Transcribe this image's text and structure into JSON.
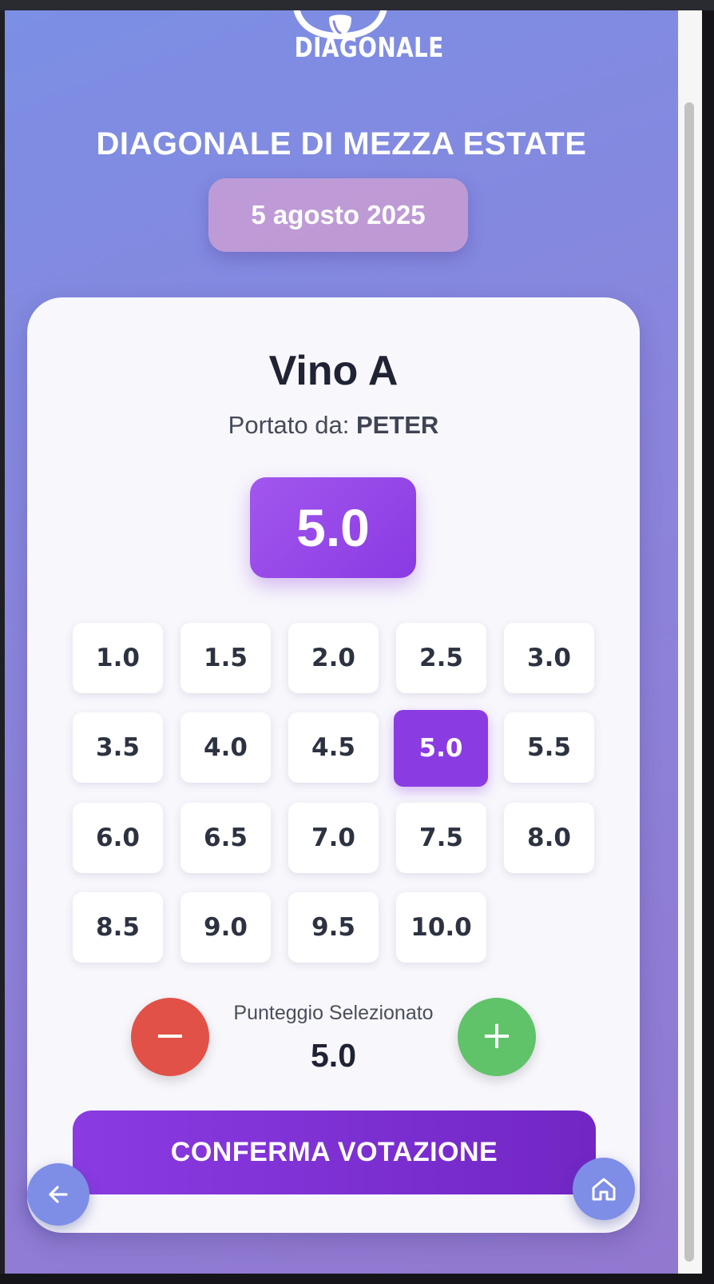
{
  "header": {
    "logo_text": "DIAGONALE",
    "event_title": "DIAGONALE DI MEZZA ESTATE",
    "event_date": "5 agosto 2025"
  },
  "wine": {
    "name": "Vino A",
    "brought_by_label": "Portato da:",
    "brought_by_name": "PETER"
  },
  "current_score": "5.0",
  "score_options": [
    "1.0",
    "1.5",
    "2.0",
    "2.5",
    "3.0",
    "3.5",
    "4.0",
    "4.5",
    "5.0",
    "5.5",
    "6.0",
    "6.5",
    "7.0",
    "7.5",
    "8.0",
    "8.5",
    "9.0",
    "9.5",
    "10.0"
  ],
  "selected_score": "5.0",
  "selector": {
    "label": "Punteggio Selezionato",
    "value": "5.0",
    "minus_symbol": "−",
    "plus_symbol": "+"
  },
  "confirm_label": "CONFERMA VOTAZIONE",
  "icons": {
    "back": "arrow-left-icon",
    "home": "home-icon",
    "logo": "grape-logo-icon"
  },
  "colors": {
    "accent": "#8a3be2",
    "minus": "#e15147",
    "plus": "#60c36a",
    "fab": "#7e8de6"
  }
}
